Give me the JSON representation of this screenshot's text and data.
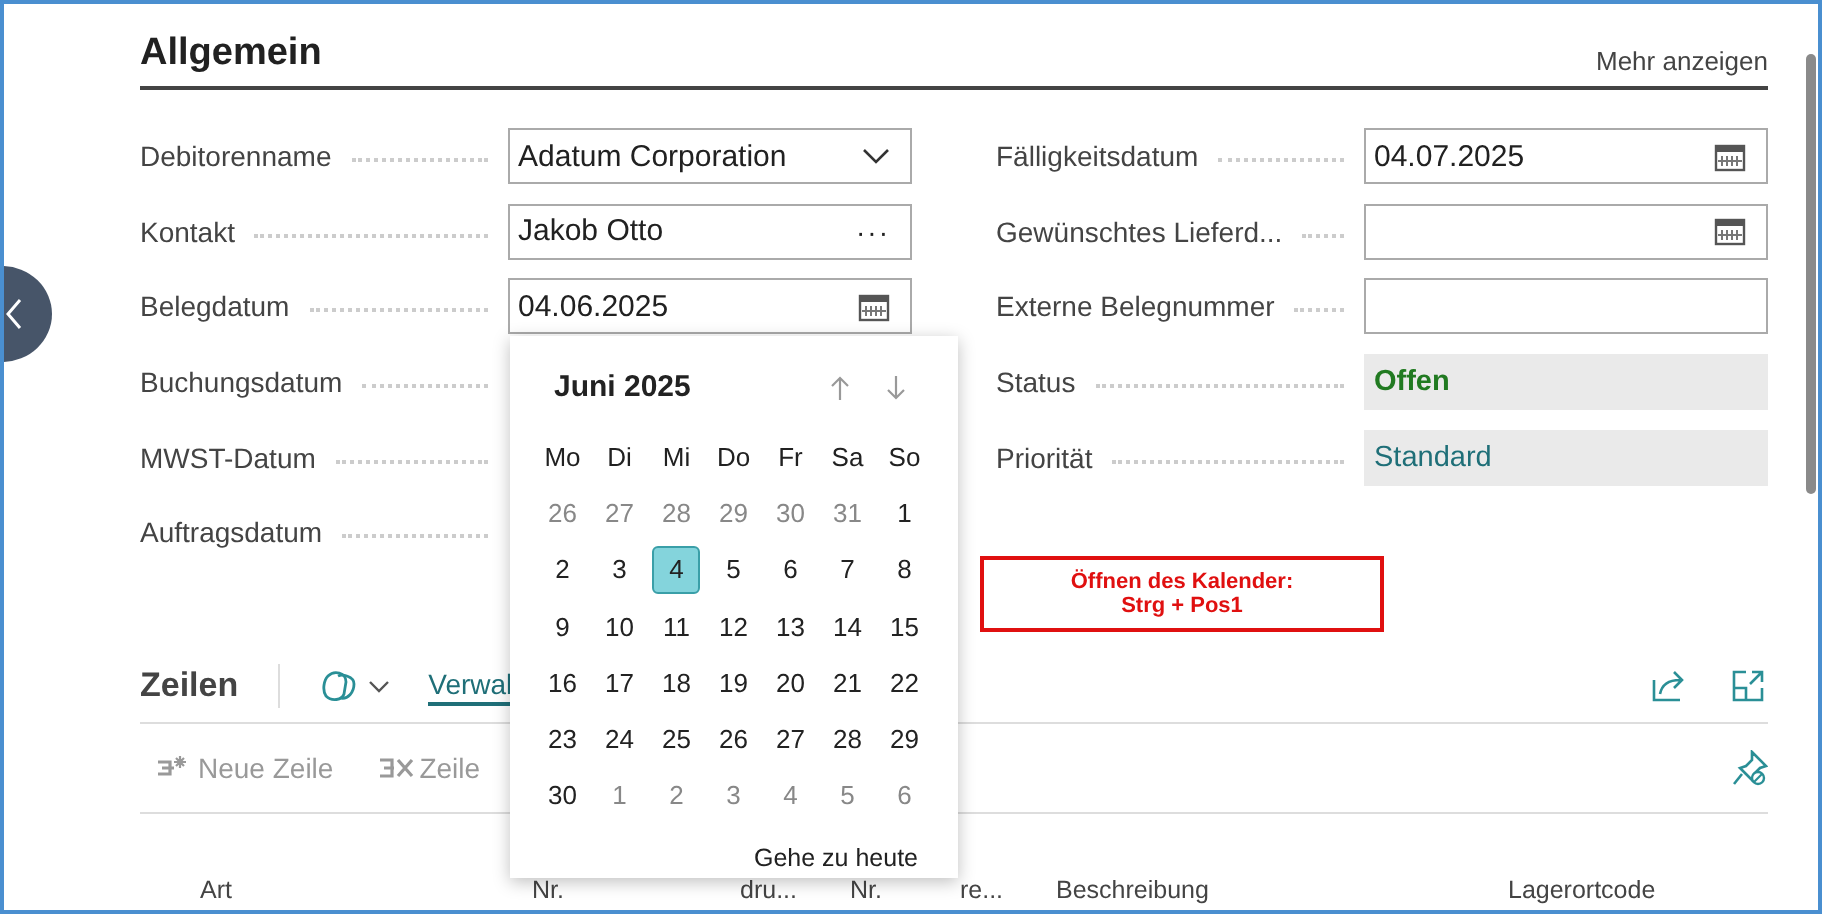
{
  "section": {
    "title": "Allgemein",
    "more_link": "Mehr anzeigen"
  },
  "left_fields": [
    {
      "label": "Debitorenname",
      "field": {
        "kind": "dropdown",
        "value": "Adatum Corporation"
      }
    },
    {
      "label": "Kontakt",
      "field": {
        "kind": "lookup",
        "value": "Jakob Otto",
        "button": "···"
      }
    },
    {
      "label": "Belegdatum",
      "field": {
        "kind": "date",
        "value": "04.06.2025"
      }
    },
    {
      "label": "Buchungsdatum"
    },
    {
      "label": "MWST-Datum"
    },
    {
      "label": "Auftragsdatum"
    }
  ],
  "right_fields": [
    {
      "label": "Fälligkeitsdatum",
      "field": {
        "kind": "date",
        "value": "04.07.2025"
      }
    },
    {
      "label": "Gewünschtes Lieferd...",
      "field": {
        "kind": "date"
      }
    },
    {
      "label": "Externe Belegnummer",
      "field": {
        "kind": "text"
      }
    },
    {
      "label": "Status",
      "field": {
        "kind": "readonly",
        "positive": true,
        "value": "Offen"
      }
    },
    {
      "label": "Priorität",
      "field": {
        "kind": "readonly",
        "positive": false,
        "value": "Standard"
      }
    }
  ],
  "calendar": {
    "month": "Juni 2025",
    "weekdays": [
      "Mo",
      "Di",
      "Mi",
      "Do",
      "Fr",
      "Sa",
      "So"
    ],
    "weeks": [
      [
        {
          "label": "26",
          "outside": true,
          "selected": false
        },
        {
          "label": "27",
          "outside": true,
          "selected": false
        },
        {
          "label": "28",
          "outside": true,
          "selected": false
        },
        {
          "label": "29",
          "outside": true,
          "selected": false
        },
        {
          "label": "30",
          "outside": true,
          "selected": false
        },
        {
          "label": "31",
          "outside": true,
          "selected": false
        },
        {
          "label": "1",
          "outside": false,
          "selected": false
        }
      ],
      [
        {
          "label": "2",
          "outside": false,
          "selected": false
        },
        {
          "label": "3",
          "outside": false,
          "selected": false
        },
        {
          "label": "4",
          "outside": false,
          "selected": true
        },
        {
          "label": "5",
          "outside": false,
          "selected": false
        },
        {
          "label": "6",
          "outside": false,
          "selected": false
        },
        {
          "label": "7",
          "outside": false,
          "selected": false
        },
        {
          "label": "8",
          "outside": false,
          "selected": false
        }
      ],
      [
        {
          "label": "9",
          "outside": false,
          "selected": false
        },
        {
          "label": "10",
          "outside": false,
          "selected": false
        },
        {
          "label": "11",
          "outside": false,
          "selected": false
        },
        {
          "label": "12",
          "outside": false,
          "selected": false
        },
        {
          "label": "13",
          "outside": false,
          "selected": false
        },
        {
          "label": "14",
          "outside": false,
          "selected": false
        },
        {
          "label": "15",
          "outside": false,
          "selected": false
        }
      ],
      [
        {
          "label": "16",
          "outside": false,
          "selected": false
        },
        {
          "label": "17",
          "outside": false,
          "selected": false
        },
        {
          "label": "18",
          "outside": false,
          "selected": false
        },
        {
          "label": "19",
          "outside": false,
          "selected": false
        },
        {
          "label": "20",
          "outside": false,
          "selected": false
        },
        {
          "label": "21",
          "outside": false,
          "selected": false
        },
        {
          "label": "22",
          "outside": false,
          "selected": false
        }
      ],
      [
        {
          "label": "23",
          "outside": false,
          "selected": false
        },
        {
          "label": "24",
          "outside": false,
          "selected": false
        },
        {
          "label": "25",
          "outside": false,
          "selected": false
        },
        {
          "label": "26",
          "outside": false,
          "selected": false
        },
        {
          "label": "27",
          "outside": false,
          "selected": false
        },
        {
          "label": "28",
          "outside": false,
          "selected": false
        },
        {
          "label": "29",
          "outside": false,
          "selected": false
        }
      ],
      [
        {
          "label": "30",
          "outside": false,
          "selected": false
        },
        {
          "label": "1",
          "outside": true,
          "selected": false
        },
        {
          "label": "2",
          "outside": true,
          "selected": false
        },
        {
          "label": "3",
          "outside": true,
          "selected": false
        },
        {
          "label": "4",
          "outside": true,
          "selected": false
        },
        {
          "label": "5",
          "outside": true,
          "selected": false
        },
        {
          "label": "6",
          "outside": true,
          "selected": false
        }
      ]
    ],
    "today_link": "Gehe zu heute"
  },
  "annotation": {
    "lines": [
      "Öffnen des Kalender:",
      "Strg + Pos1"
    ]
  },
  "lines_section": {
    "title": "Zeilen",
    "link": "Verwal",
    "actions": [
      {
        "label": "Neue Zeile",
        "kind": "new",
        "disabled": true
      },
      {
        "label": "Zeile",
        "kind": "delete",
        "disabled": true
      }
    ],
    "columns": [
      "Art",
      "Nr.",
      "dru...",
      "Nr.",
      "re...",
      "Beschreibung",
      "Lagerortcode"
    ]
  }
}
